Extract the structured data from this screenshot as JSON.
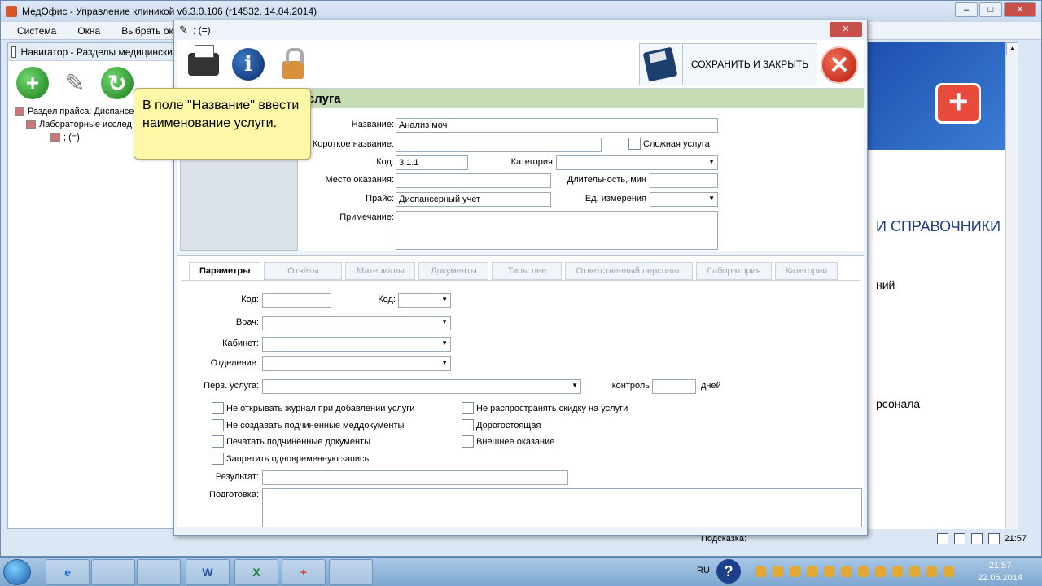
{
  "main_window": {
    "title": "МедОфис - Управление клиникой v6.3.0.106 (r14532, 14.04.2014)",
    "controls": {
      "minimize": "–",
      "maximize": "□",
      "close": "✕"
    },
    "menu": [
      "Система",
      "Окна",
      "Выбрать ок"
    ]
  },
  "navigator": {
    "title": "Навигатор - Разделы медицинских",
    "tree": [
      "Раздел прайса: Диспансер",
      "Лабораторные исслед",
      "; (=)"
    ]
  },
  "right_panel": {
    "section_title": "И СПРАВОЧНИКИ",
    "text1": "ний",
    "text2": "рсонала"
  },
  "statusbar": {
    "hint_label": "Подсказка:",
    "clock": "21:57"
  },
  "dialog": {
    "title": "; (=)",
    "close_symbol": "✕",
    "save_close_label": "СОХРАНИТЬ И ЗАКРЫТЬ",
    "section_title": "услуга",
    "fields": {
      "name_label": "Название:",
      "name_value": "Анализ моч",
      "short_name_label": "Короткое название:",
      "short_name_value": "",
      "complex_label": "Сложная услуга",
      "code_label": "Код:",
      "code_value": "3.1.1",
      "category_label": "Категория",
      "category_value": "",
      "place_label": "Место оказания:",
      "place_value": "",
      "duration_label": "Длительность, мин",
      "duration_value": "",
      "price_label": "Прайс:",
      "price_value": "Диспансерный учет",
      "unit_label": "Ед. измерения",
      "unit_value": "",
      "note_label": "Примечание:",
      "note_value": ""
    },
    "tabs": [
      "Параметры",
      "Отчёты",
      "Материалы",
      "Документы",
      "Типы цен",
      "Ответственный персонал",
      "Лаборатория",
      "Категории"
    ],
    "params": {
      "code_label": "Код:",
      "code2_label": "Код:",
      "doctor_label": "Врач:",
      "cabinet_label": "Кабинет:",
      "department_label": "Отделение:",
      "first_service_label": "Перв. услуга:",
      "control_label": "контроль",
      "days_label": "дней",
      "checkboxes_left": [
        "Не открывать журнал при добавлении услуги",
        "Не создавать подчиненные меддокументы",
        "Печатать подчиненные документы",
        "Запретить одновременную запись"
      ],
      "checkboxes_right": [
        "Не распространять скидку на услуги",
        "Дорогостоящая",
        "Внешнее оказание"
      ],
      "result_label": "Результат:",
      "prep_label": "Подготовка:"
    }
  },
  "callout": {
    "text": "В поле \"Название\" ввести наименование услуги."
  },
  "taskbar": {
    "apps": [
      "e",
      "",
      "",
      "W",
      "X",
      "+",
      ""
    ],
    "lang": "RU",
    "help": "?",
    "time": "21:57",
    "date": "22.06.2014"
  }
}
